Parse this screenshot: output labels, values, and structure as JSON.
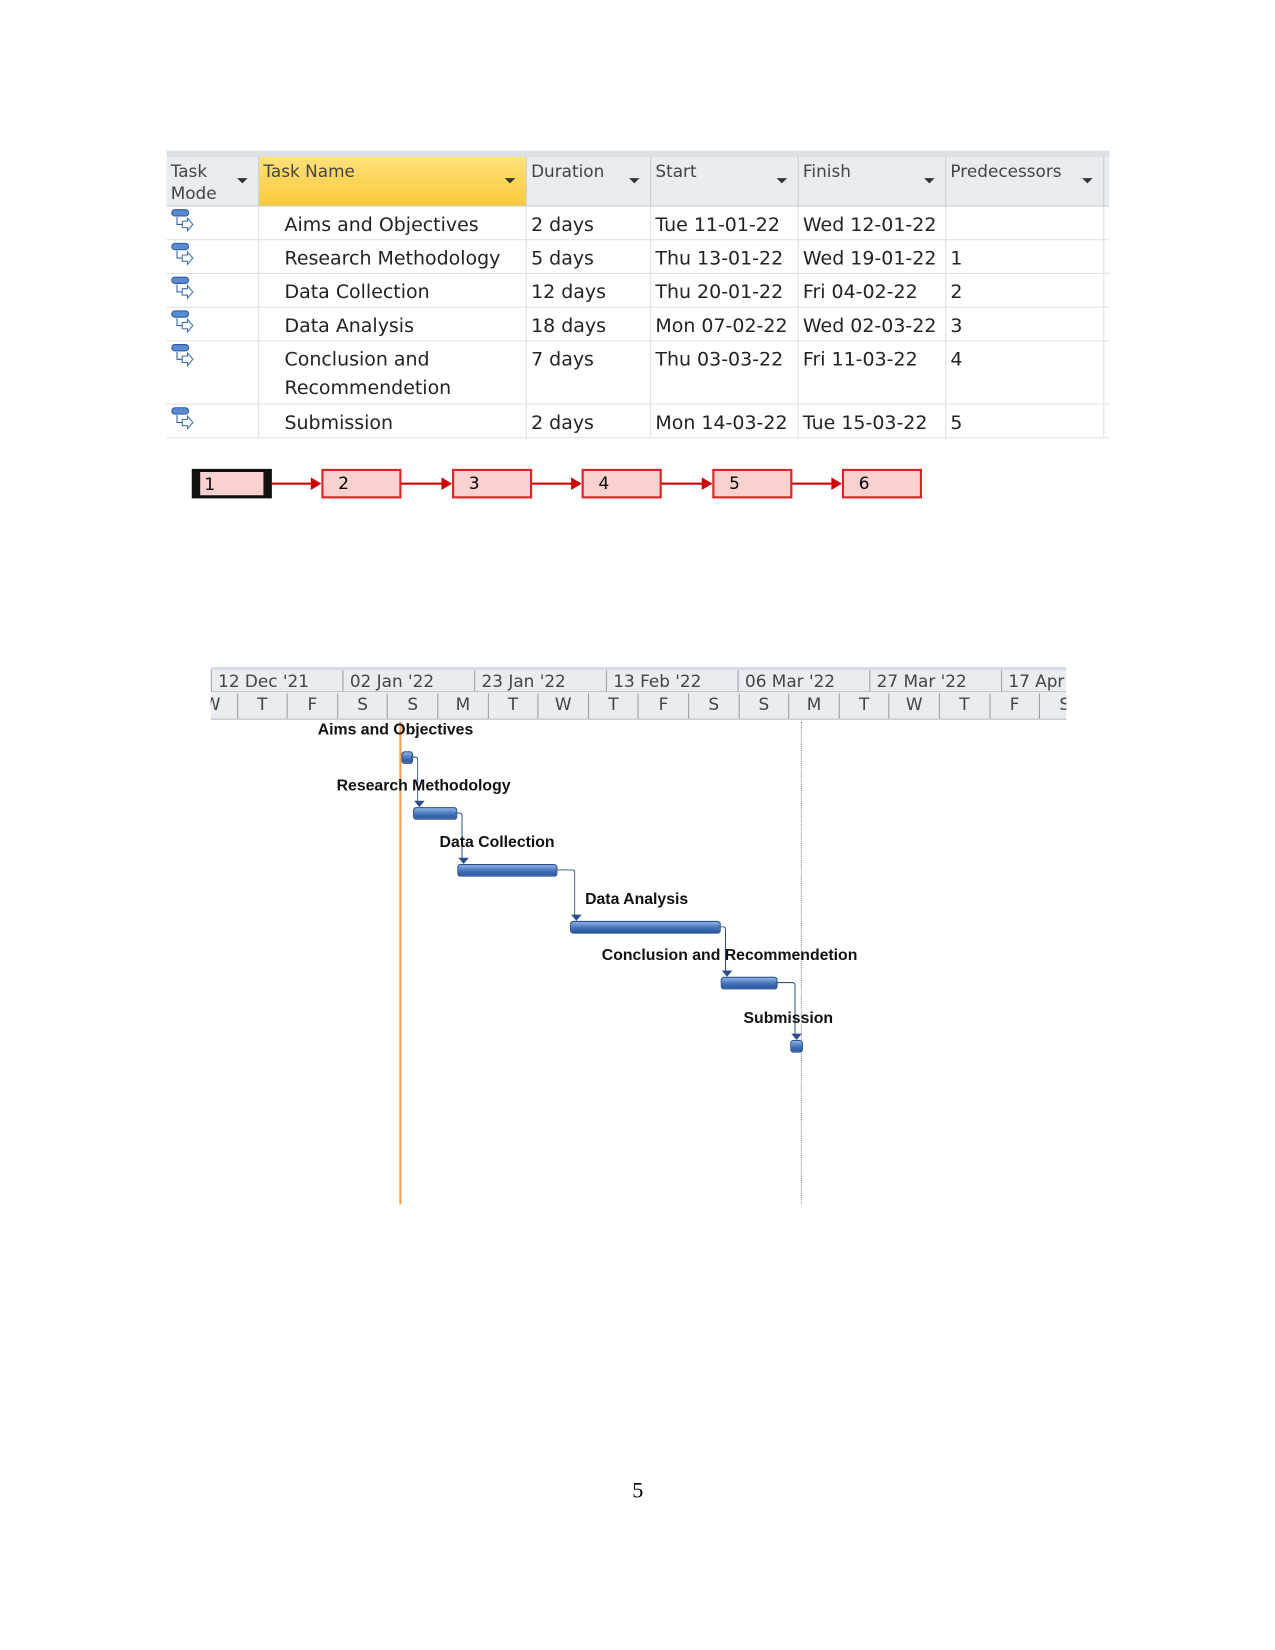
{
  "table": {
    "headers": [
      "Task Mode",
      "Task Name",
      "Duration",
      "Start",
      "Finish",
      "Predecessors"
    ],
    "rows": [
      {
        "name": "Aims and Objectives",
        "duration": "2 days",
        "start": "Tue 11-01-22",
        "finish": "Wed 12-01-22",
        "pred": ""
      },
      {
        "name": "Research Methodology",
        "duration": "5 days",
        "start": "Thu 13-01-22",
        "finish": "Wed 19-01-22",
        "pred": "1"
      },
      {
        "name": "Data Collection",
        "duration": "12 days",
        "start": "Thu 20-01-22",
        "finish": "Fri 04-02-22",
        "pred": "2"
      },
      {
        "name": "Data Analysis",
        "duration": "18 days",
        "start": "Mon 07-02-22",
        "finish": "Wed 02-03-22",
        "pred": "3"
      },
      {
        "name": "Conclusion and Recommendetion",
        "duration": "7 days",
        "start": "Thu 03-03-22",
        "finish": "Fri 11-03-22",
        "pred": "4"
      },
      {
        "name": "Submission",
        "duration": "2 days",
        "start": "Mon 14-03-22",
        "finish": "Tue 15-03-22",
        "pred": "5"
      }
    ],
    "mode_icon": "auto-scheduled-task-icon",
    "selected_header_color": "#f9c93a"
  },
  "network": {
    "nodes": [
      "1",
      "2",
      "3",
      "4",
      "5",
      "6"
    ],
    "box_color": "#fbd0d0",
    "link_color": "#cc0000"
  },
  "chart_data": {
    "type": "gantt",
    "timescale_top": [
      "12 Dec '21",
      "02 Jan '22",
      "23 Jan '22",
      "13 Feb '22",
      "06 Mar '22",
      "27 Mar '22",
      "17 Apr"
    ],
    "timescale_bottom": [
      "W",
      "T",
      "F",
      "S",
      "S",
      "M",
      "T",
      "W",
      "T",
      "F",
      "S",
      "S",
      "M",
      "T",
      "W",
      "T",
      "F",
      "S"
    ],
    "tasks": [
      {
        "name": "Aims and Objectives",
        "start": "2022-01-11",
        "finish": "2022-01-12"
      },
      {
        "name": "Research Methodology",
        "start": "2022-01-13",
        "finish": "2022-01-19"
      },
      {
        "name": "Data Collection",
        "start": "2022-01-20",
        "finish": "2022-02-04"
      },
      {
        "name": "Data Analysis",
        "start": "2022-02-07",
        "finish": "2022-03-02"
      },
      {
        "name": "Conclusion and Recommendetion",
        "start": "2022-03-03",
        "finish": "2022-03-11"
      },
      {
        "name": "Submission",
        "start": "2022-03-14",
        "finish": "2022-03-15"
      }
    ],
    "bar_color": "#3d6db8",
    "current_date_line_color": "#f0a050"
  },
  "page_number": "5"
}
